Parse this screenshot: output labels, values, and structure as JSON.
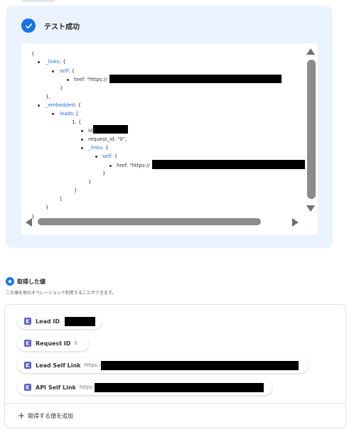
{
  "result": {
    "title": "テスト成功",
    "json_lines": {
      "open": "{",
      "links_key": "_links",
      "links_open": ": {",
      "self_key": "self",
      "self_open": ": {",
      "href_text": "href: \"https://",
      "close_inner": "}",
      "close_links": "},",
      "embedded_key": "_embedded",
      "embedded_open": ": {",
      "leads_key": "leads",
      "leads_open": ": [",
      "item_open": "1. {",
      "id_text": "id",
      "request_id_text": "request_id: \"0\",",
      "links2_key": "_links",
      "links2_open": ": {",
      "self2_key": "self",
      "self2_open": ": {",
      "href2_text": "href: \"https://",
      "close_self2": "}",
      "close_links2": "}",
      "close_item": "}",
      "close_array": "]",
      "close_embedded": "}",
      "close_root": "}"
    }
  },
  "values": {
    "title": "取得した値",
    "subtitle": "この値を他のオペレーションで利用することができます。",
    "chips": [
      {
        "label": "Lead ID",
        "value": ""
      },
      {
        "label": "Request ID",
        "value": "0"
      },
      {
        "label": "Lead Self Link",
        "value": "https:/"
      },
      {
        "label": "API Self Link",
        "value": "https:"
      }
    ],
    "add_label": "取得する値を追加"
  },
  "colors": {
    "accent": "#1a73e8",
    "panel_bg": "#eaf3fd",
    "chip_icon": "#5a5fcf"
  },
  "icons": {
    "success": "check-circle-icon",
    "section": "badge-star-icon",
    "chip": "app-logo-icon",
    "add": "plus-icon"
  }
}
